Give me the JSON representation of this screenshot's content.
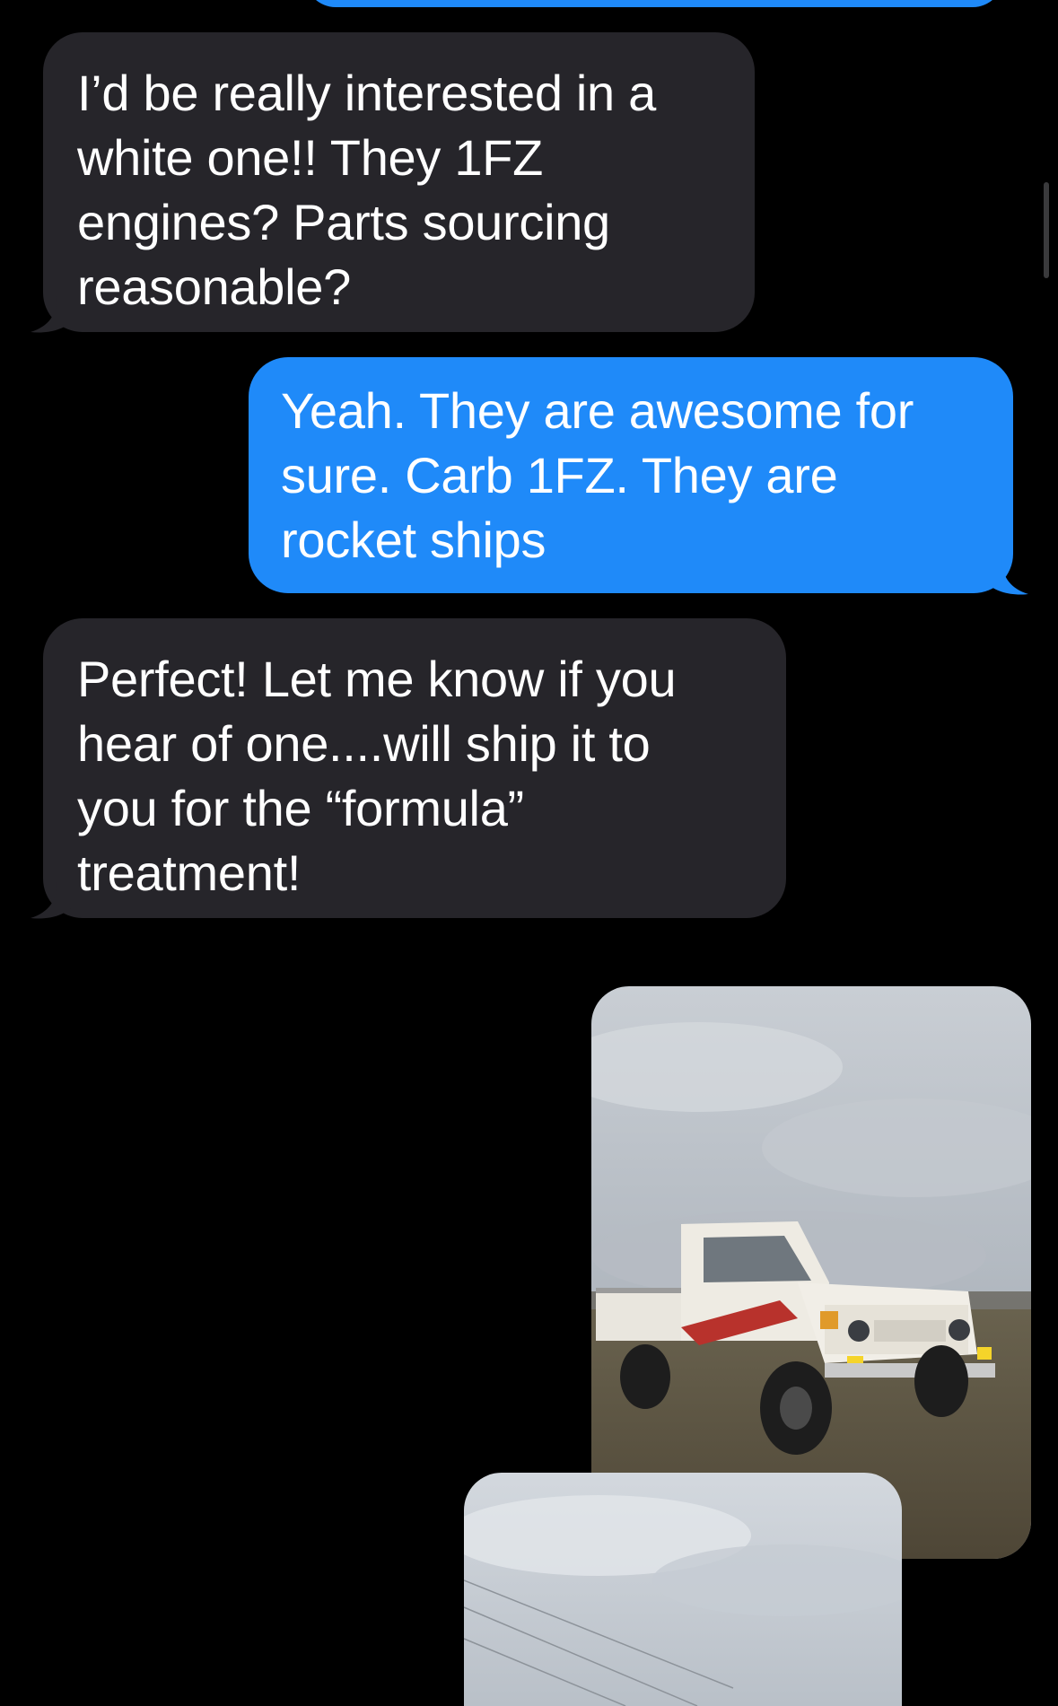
{
  "conversation": {
    "messages": [
      {
        "direction": "incoming",
        "lines": [
          "I’d be really interested in a",
          "white one!! They 1FZ",
          "engines? Parts sourcing",
          "reasonable?"
        ]
      },
      {
        "direction": "outgoing",
        "lines": [
          "Yeah. They are awesome for",
          "sure. Carb 1FZ. They are",
          "rocket ships"
        ]
      },
      {
        "direction": "incoming",
        "lines": [
          "Perfect! Let me know if you",
          "hear of one....will ship it to",
          "you for the “formula”",
          "treatment!"
        ]
      }
    ],
    "attachments": [
      {
        "type": "photo",
        "direction": "outgoing"
      },
      {
        "type": "photo",
        "direction": "outgoing"
      }
    ]
  },
  "colors": {
    "background": "#000000",
    "incoming_bubble": "#26252A",
    "outgoing_bubble": "#1F8AF9",
    "text": "#FFFFFF"
  }
}
